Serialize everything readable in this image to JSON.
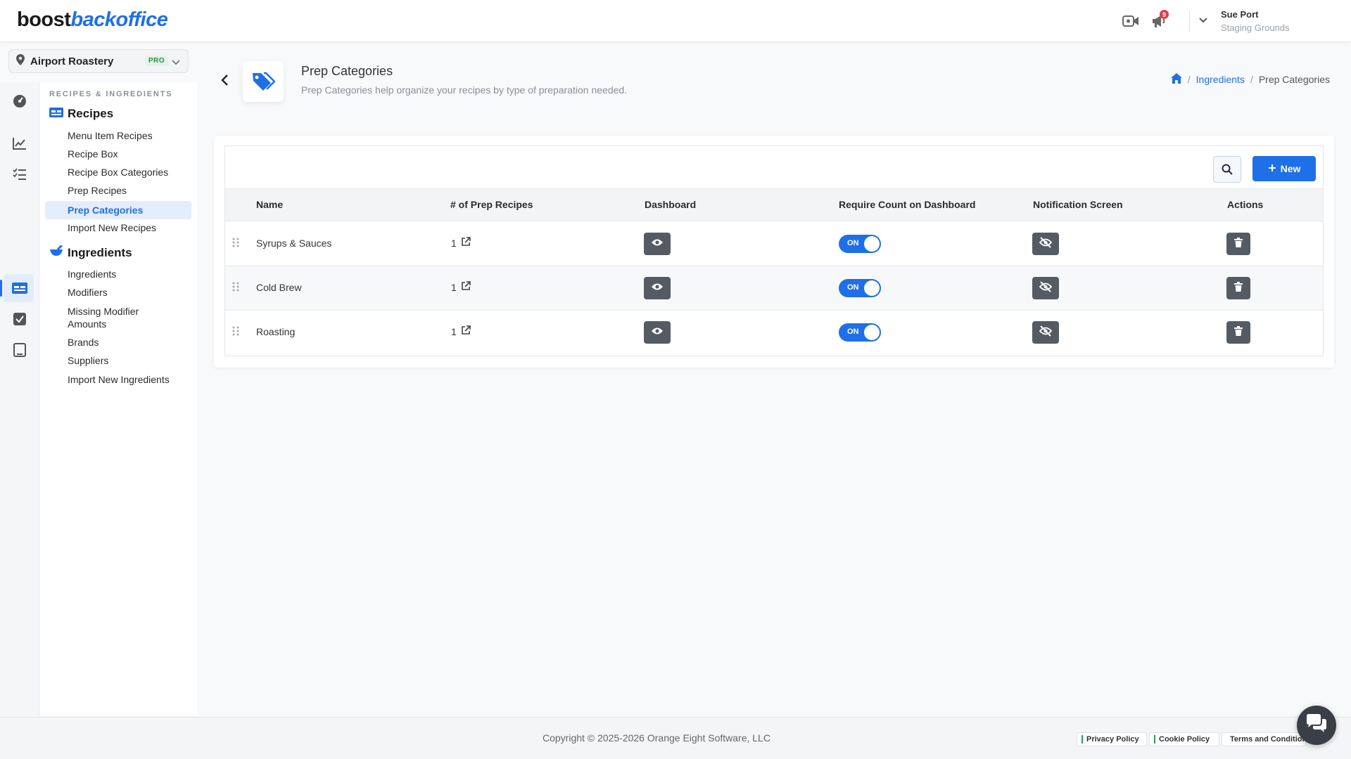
{
  "brand": {
    "logo_part1": "boost",
    "logo_part2": "backoffice"
  },
  "header": {
    "notification_count": "9",
    "user_name": "Sue Port",
    "user_org": "Staging Grounds"
  },
  "location": {
    "name": "Airport Roastery",
    "plan": "PRO"
  },
  "sidebar": {
    "section_heading": "RECIPES & INGREDIENTS",
    "groups": [
      {
        "label": "Recipes",
        "items": [
          "Menu Item Recipes",
          "Recipe Box",
          "Recipe Box Categories",
          "Prep Recipes",
          "Prep Categories",
          "Import New Recipes"
        ]
      },
      {
        "label": "Ingredients",
        "items": [
          "Ingredients",
          "Modifiers",
          "Missing Modifier Amounts",
          "Brands",
          "Suppliers",
          "Import New Ingredients"
        ]
      }
    ],
    "active_item": "Prep Categories"
  },
  "page": {
    "title": "Prep Categories",
    "subtitle": "Prep Categories help organize your recipes by type of preparation needed.",
    "breadcrumb": {
      "link": "Ingredients",
      "current": "Prep Categories"
    }
  },
  "toolbar": {
    "new_label": "New"
  },
  "table": {
    "columns": [
      "Name",
      "# of Prep Recipes",
      "Dashboard",
      "Require Count on Dashboard",
      "Notification Screen",
      "Actions"
    ],
    "rows": [
      {
        "name": "Syrups & Sauces",
        "count": "1",
        "require_count": "ON"
      },
      {
        "name": "Cold Brew",
        "count": "1",
        "require_count": "ON"
      },
      {
        "name": "Roasting",
        "count": "1",
        "require_count": "ON"
      }
    ]
  },
  "footer": {
    "copyright": "Copyright © 2025-2026 Orange Eight Software, LLC",
    "links": [
      "Privacy Policy",
      "Cookie Policy",
      "Terms and Conditions"
    ]
  },
  "colors": {
    "accent": "#1f6fe8",
    "dark_button": "#555b63",
    "badge": "#e23b4a"
  }
}
